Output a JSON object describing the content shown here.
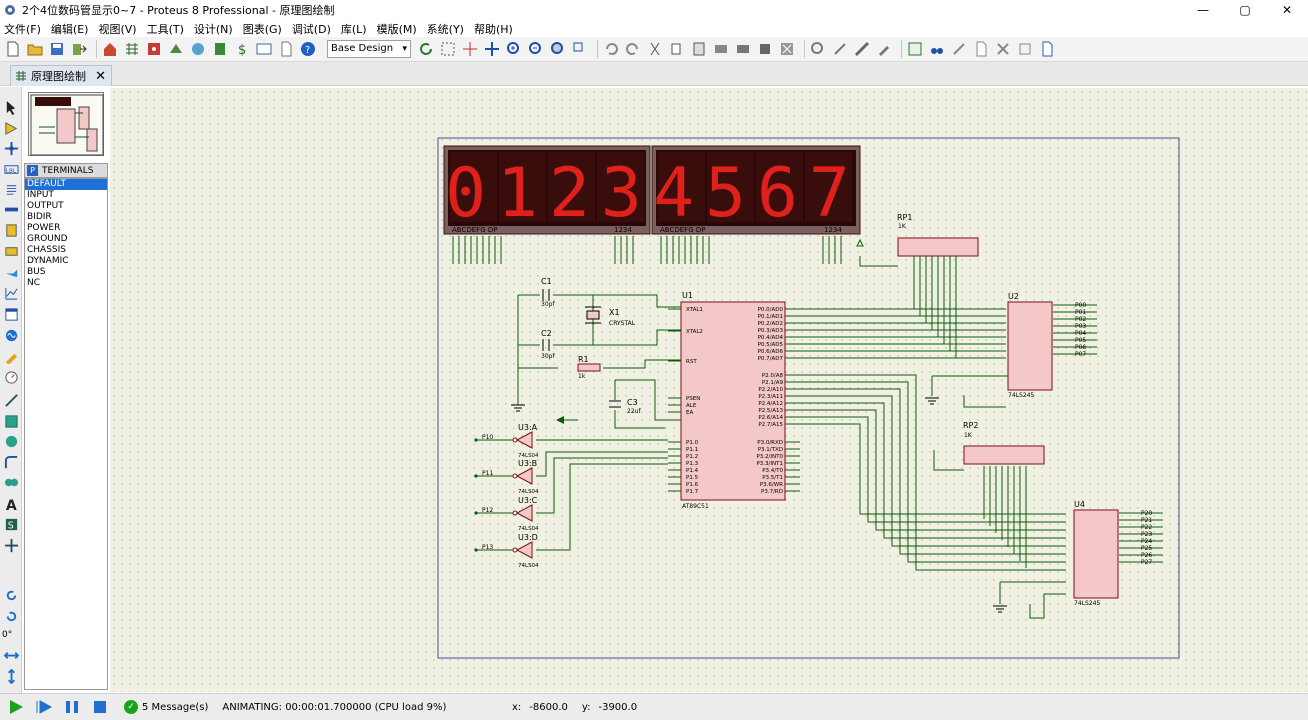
{
  "window": {
    "title": "2个4位数码管显示0~7 - Proteus 8 Professional - 原理图绘制"
  },
  "menu": [
    "文件(F)",
    "编辑(E)",
    "视图(V)",
    "工具(T)",
    "设计(N)",
    "图表(G)",
    "调试(D)",
    "库(L)",
    "模版(M)",
    "系统(Y)",
    "帮助(H)"
  ],
  "toolbar": {
    "design_select": "Base Design"
  },
  "tab": {
    "label": "原理图绘制"
  },
  "selector": {
    "header_badge": "P",
    "header_label": "TERMINALS",
    "items": [
      "DEFAULT",
      "INPUT",
      "OUTPUT",
      "BIDIR",
      "POWER",
      "GROUND",
      "CHASSIS",
      "DYNAMIC",
      "BUS",
      "NC"
    ],
    "selected_index": 0
  },
  "rotation": "0°",
  "schematic": {
    "display1_digits": "0123",
    "display2_digits": "4567",
    "display_seg_label": "ABCDEFG DP",
    "display_com_label": "1234",
    "labels": {
      "c1": "C1",
      "c1v": "30pf",
      "c2": "C2",
      "c2v": "30pf",
      "x1": "X1",
      "x1v": "CRYSTAL",
      "r1": "R1",
      "r1v": "1k",
      "c3": "C3",
      "c3v": "22uf",
      "u1": "U1",
      "u1type": "AT89C51",
      "rp1": "RP1",
      "rp1v": "1K",
      "rp2": "RP2",
      "rp2v": "1K",
      "u2": "U2",
      "u2type": "74LS245",
      "u4": "U4",
      "u4type": "74LS245",
      "u3a": "U3:A",
      "u3b": "U3:B",
      "u3c": "U3:C",
      "u3d": "U3:D",
      "gate_type": "74LS04",
      "text_tag": "<TEXT>"
    },
    "u1_left_pins": [
      "XTAL1",
      "XTAL2",
      "RST",
      "PSEN",
      "ALE",
      "EA",
      "P1.0",
      "P1.1",
      "P1.2",
      "P1.3",
      "P1.4",
      "P1.5",
      "P1.6",
      "P1.7"
    ],
    "u1_right_pins": [
      "P0.0/AD0",
      "P0.1/AD1",
      "P0.2/AD2",
      "P0.3/AD3",
      "P0.4/AD4",
      "P0.5/AD5",
      "P0.6/AD6",
      "P0.7/AD7",
      "P2.0/A8",
      "P2.1/A9",
      "P2.2/A10",
      "P2.3/A11",
      "P2.4/A12",
      "P2.5/A13",
      "P2.6/A14",
      "P2.7/A15",
      "P3.0/RXD",
      "P3.1/TXD",
      "P3.2/INT0",
      "P3.3/INT1",
      "P3.4/T0",
      "P3.5/T1",
      "P3.6/WR",
      "P3.7/RD"
    ],
    "p1_terminals": [
      "P10",
      "P11",
      "P12",
      "P13"
    ],
    "u2_outputs": [
      "P00",
      "P01",
      "P02",
      "P03",
      "P04",
      "P05",
      "P06",
      "P07"
    ],
    "u4_outputs": [
      "P20",
      "P21",
      "P22",
      "P23",
      "P24",
      "P25",
      "P26",
      "P27"
    ]
  },
  "status": {
    "messages": "5 Message(s)",
    "animating": "ANIMATING: 00:00:01.700000 (CPU load 9%)",
    "x_label": "x:",
    "x_value": "-8600.0",
    "y_label": "y:",
    "y_value": "-3900.0"
  },
  "colors": {
    "segment_on": "#e0201a",
    "display_bg": "#3a0d0d",
    "wire": "#0a5a0a",
    "component_fill": "#f4c8c8",
    "component_stroke": "#7a1010"
  }
}
